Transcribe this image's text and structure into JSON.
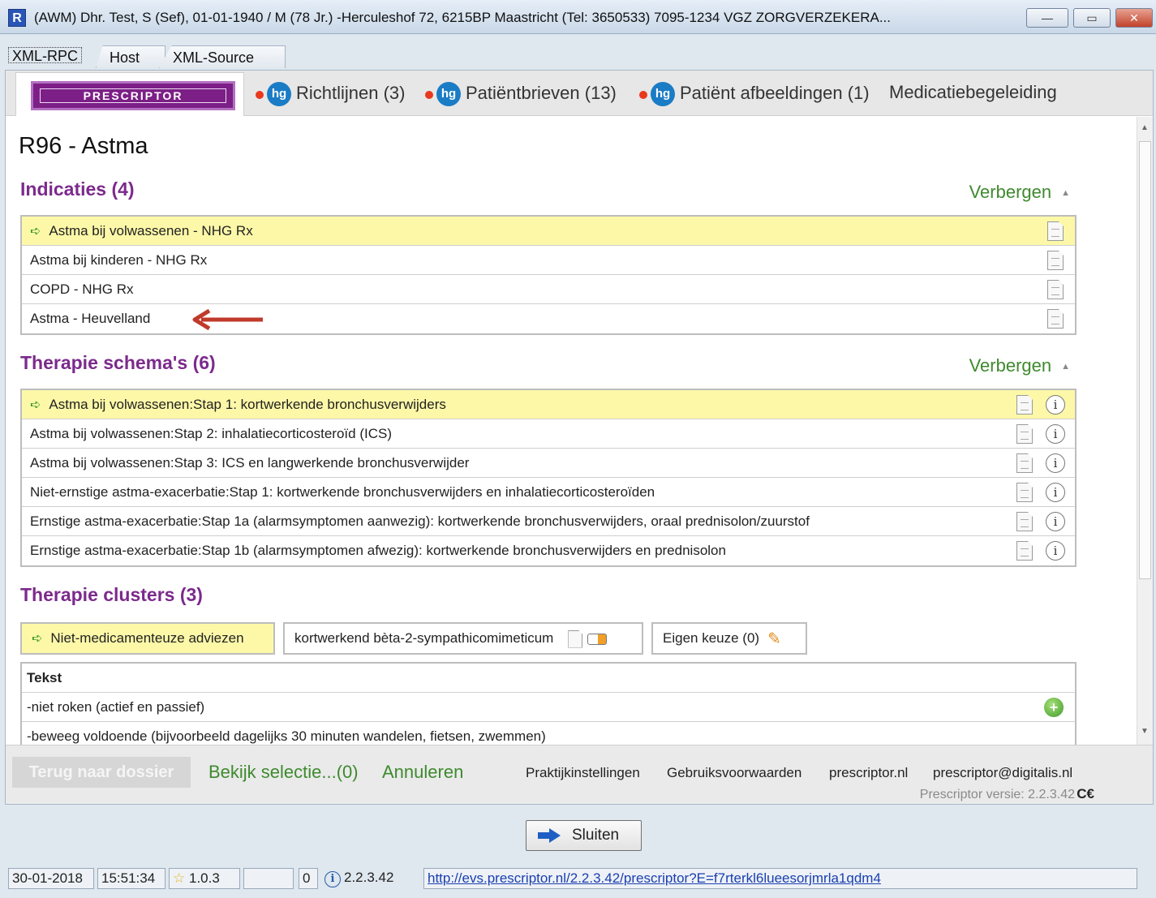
{
  "window": {
    "title": "(AWM) Dhr. Test, S (Sef), 01-01-1940 / M (78 Jr.) -Herculeshof 72, 6215BP Maastricht (Tel: 3650533) 7095-1234 VGZ ZORGVERZEKERA...",
    "app_icon": "R",
    "minimize_glyph": "—",
    "maximize_glyph": "▭",
    "close_glyph": "✕"
  },
  "outer_tabs": [
    "XML-RPC",
    "Host",
    "XML-Source"
  ],
  "app_tabs": {
    "logo": "PRESCRIPTOR",
    "nhg_icon_text": "hg",
    "items": [
      "Richtlijnen (3)",
      "Patiëntbrieven (13)",
      "Patiënt afbeeldingen (1)",
      "Medicatiebegeleiding"
    ]
  },
  "page": {
    "title": "R96 - Astma",
    "hide_label": "Verbergen",
    "indicaties": {
      "title": "Indicaties (4)",
      "rows": [
        "Astma bij volwassenen - NHG Rx",
        "Astma bij kinderen - NHG Rx",
        "COPD - NHG Rx",
        "Astma - Heuvelland"
      ]
    },
    "therapie_schemas": {
      "title": "Therapie schema's (6)",
      "rows": [
        "Astma bij volwassenen:Stap 1: kortwerkende bronchusverwijders",
        "Astma bij volwassenen:Stap 2: inhalatiecorticosteroïd (ICS)",
        "Astma bij volwassenen:Stap 3: ICS en langwerkende bronchusverwijder",
        "Niet-ernstige astma-exacerbatie:Stap 1: kortwerkende bronchusverwijders en inhalatiecorticosteroïden",
        "Ernstige astma-exacerbatie:Stap 1a (alarmsymptomen aanwezig): kortwerkende bronchusverwijders, oraal prednisolon/zuurstof",
        "Ernstige astma-exacerbatie:Stap 1b (alarmsymptomen afwezig): kortwerkende bronchusverwijders en prednisolon"
      ]
    },
    "therapie_clusters": {
      "title": "Therapie clusters (3)",
      "buttons": [
        "Niet-medicamenteuze adviezen",
        "kortwerkend bèta-2-sympathicomimeticum",
        "Eigen keuze (0)"
      ]
    },
    "tekst_table": {
      "header": "Tekst",
      "rows": [
        "-niet roken (actief en passief)",
        "-beweeg voldoende (bijvoorbeeld dagelijks 30 minuten wandelen, fietsen, zwemmen)"
      ]
    }
  },
  "footer": {
    "back_button": "Terug naar dossier",
    "view_selection": "Bekijk selectie...(0)",
    "cancel": "Annuleren",
    "links": [
      "Praktijkinstellingen",
      "Gebruiksvoorwaarden",
      "prescriptor.nl",
      "prescriptor@digitalis.nl"
    ],
    "version": "Prescriptor versie: 2.2.3.42",
    "ce_mark": "C€"
  },
  "close_button": "Sluiten",
  "statusbar": {
    "date": "30-01-2018",
    "time": "15:51:34",
    "rating": "1.0.3",
    "count": "0",
    "version": "2.2.3.42",
    "url": "http://evs.prescriptor.nl/2.2.3.42/prescriptor?E=f7rterkl6lueesorjmrla1qdm4"
  },
  "colors": {
    "section_purple": "#7c2a8c",
    "link_green": "#3e8a2e",
    "selected_yellow": "#fdf8a8",
    "annotation_red": "#c0392b"
  }
}
